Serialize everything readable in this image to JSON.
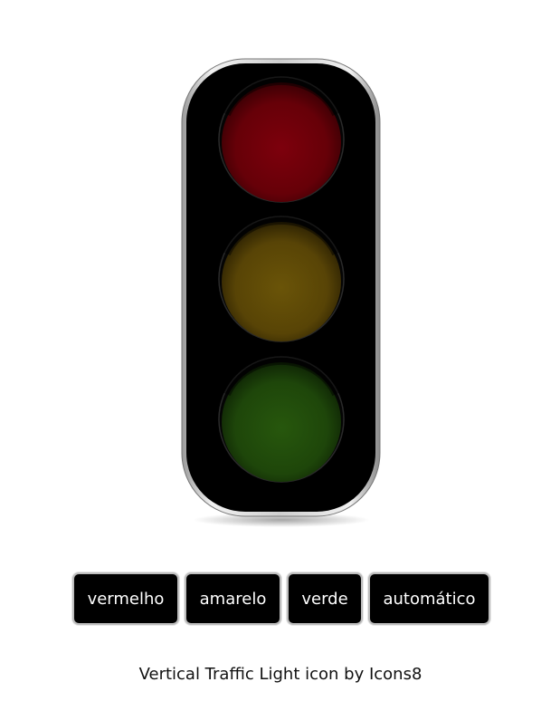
{
  "traffic_light": {
    "lamps": [
      {
        "name": "red",
        "color": "#6e0008",
        "state": "off"
      },
      {
        "name": "yellow",
        "color": "#5e4a06",
        "state": "off"
      },
      {
        "name": "green",
        "color": "#1f4a0a",
        "state": "off"
      }
    ],
    "housing_color": "#000000",
    "frame_color": "#c8c8c8"
  },
  "controls": {
    "red_label": "vermelho",
    "yellow_label": "amarelo",
    "green_label": "verde",
    "auto_label": "automático"
  },
  "footer": {
    "caption": "Vertical Traffic Light icon by Icons8"
  }
}
